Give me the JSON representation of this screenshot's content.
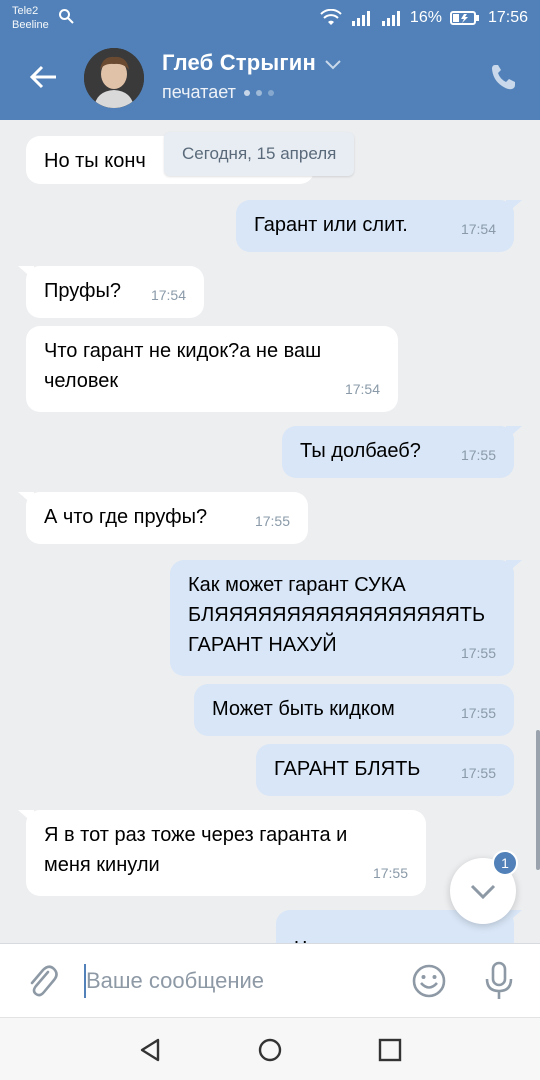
{
  "status_bar": {
    "carrier_1": "Tele2",
    "carrier_2": "Beeline",
    "battery": "16%",
    "time": "17:56"
  },
  "header": {
    "contact_name": "Глеб Стрыгин",
    "status": "печатает"
  },
  "date_separator": "Сегодня, 15 апреля",
  "messages": [
    {
      "dir": "in",
      "text": "Но ты конч",
      "time": ""
    },
    {
      "dir": "out",
      "text": "Гарант или слит.",
      "time": "17:54"
    },
    {
      "dir": "in",
      "text": "Пруфы?",
      "time": "17:54"
    },
    {
      "dir": "in",
      "text": "Что гарант не кидок?а не ваш\nчеловек",
      "time": "17:54"
    },
    {
      "dir": "out",
      "text": "Ты долбаеб?",
      "time": "17:55"
    },
    {
      "dir": "in",
      "text": "А что где пруфы?",
      "time": "17:55"
    },
    {
      "dir": "out",
      "text": "Как может гарант СУКА\nБЛЯЯЯЯЯЯЯЯЯЯЯЯЯЯЯЯЯТЬ\nГАРАНТ НАХУЙ",
      "time": "17:55"
    },
    {
      "dir": "out",
      "text": "Может быть кидком",
      "time": "17:55"
    },
    {
      "dir": "out",
      "text": "ГАРАНТ БЛЯТЬ",
      "time": "17:55"
    },
    {
      "dir": "in",
      "text": "Я в тот раз тоже через гаранта и\nменя кинули",
      "time": "17:55"
    },
    {
      "dir": "out",
      "text": "Через какого",
      "time": ""
    }
  ],
  "unread_badge": "1",
  "composer": {
    "placeholder": "Ваше сообщение"
  },
  "colors": {
    "brand": "#5181b8",
    "incoming_bubble": "#ffffff",
    "outgoing_bubble": "#d8e6f7",
    "chat_background": "#edeef0"
  },
  "icons": [
    "back-arrow-icon",
    "chevron-down-icon",
    "phone-icon",
    "paperclip-icon",
    "emoji-icon",
    "microphone-icon",
    "scroll-down-icon"
  ]
}
